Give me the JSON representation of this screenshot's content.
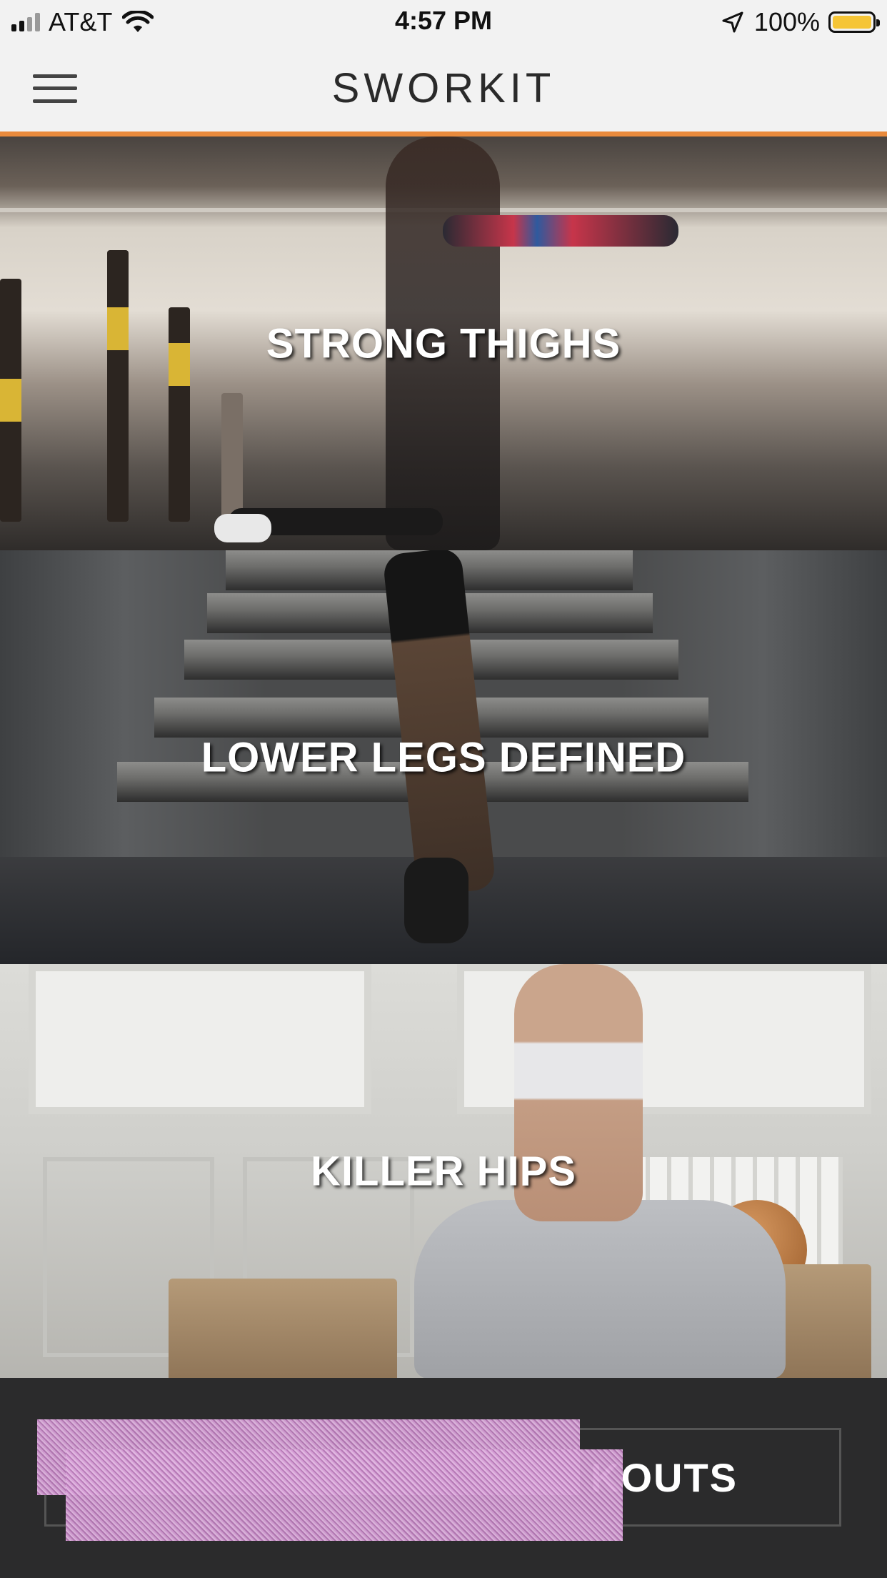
{
  "status_bar": {
    "carrier": "AT&T",
    "time": "4:57 PM",
    "battery_percent": "100%",
    "icons": [
      "signal-icon",
      "wifi-icon",
      "location-arrow-icon",
      "battery-icon"
    ]
  },
  "nav": {
    "brand": "SWORKIT",
    "menu_icon": "hamburger-menu-icon",
    "accent_color": "#e98a3c"
  },
  "workouts": [
    {
      "title": "STRONG THIGHS"
    },
    {
      "title": "LOWER LEGS DEFINED"
    },
    {
      "title": "KILLER HIPS"
    }
  ],
  "bottom": {
    "button_label_visible": "KOUTS"
  }
}
